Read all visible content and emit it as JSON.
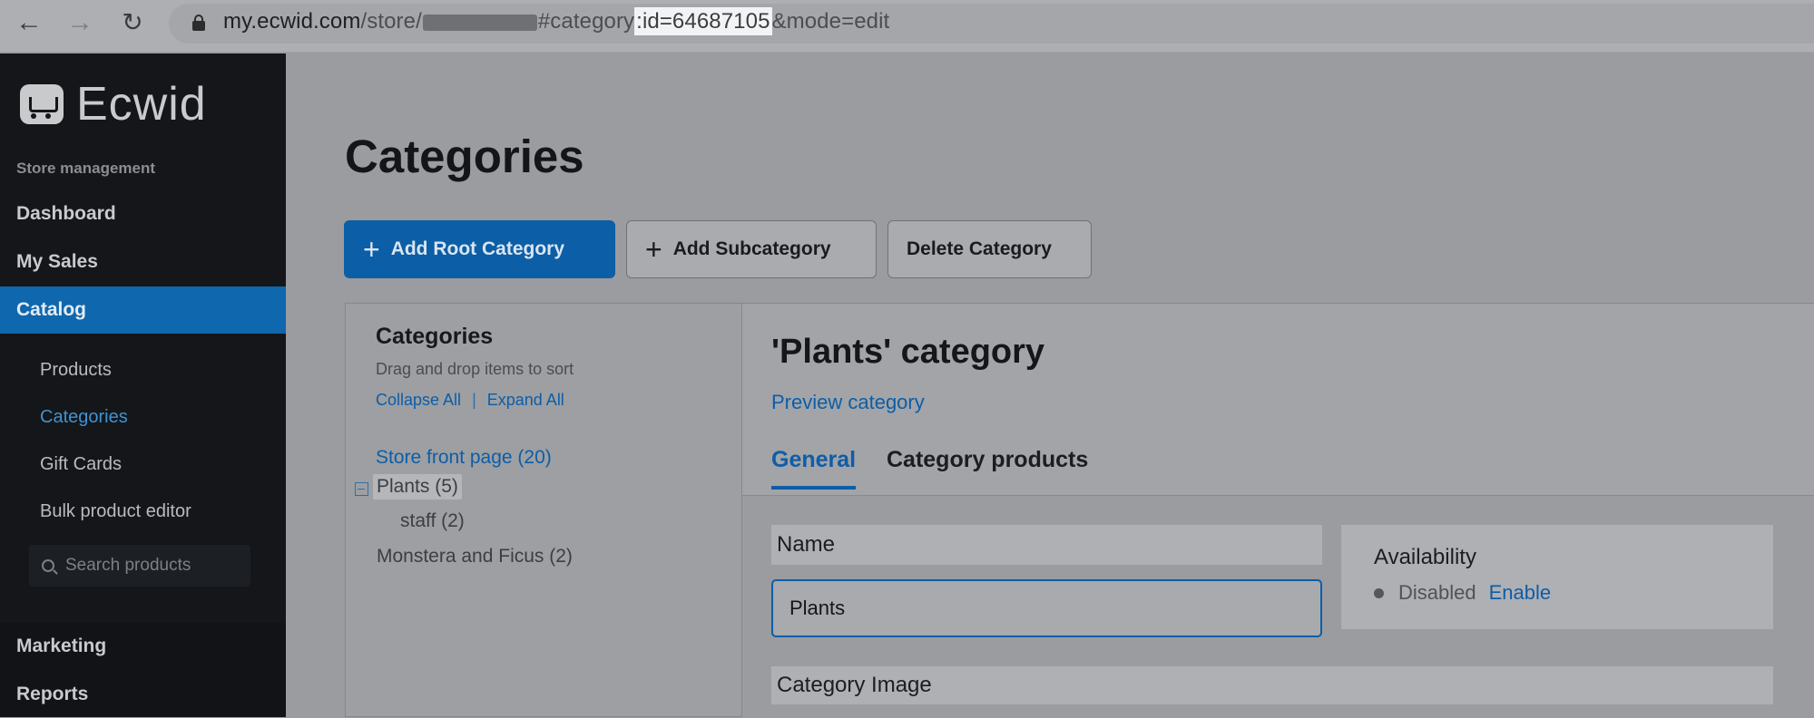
{
  "browser": {
    "url_host": "my.ecwid.com",
    "url_path_prefix": "/store/",
    "url_after_redact": "#category",
    "url_highlight": ":id=64687105",
    "url_suffix": "&mode=edit"
  },
  "sidebar": {
    "brand": "Ecwid",
    "section_label": "Store management",
    "items": [
      {
        "label": "Dashboard"
      },
      {
        "label": "My Sales"
      },
      {
        "label": "Catalog"
      }
    ],
    "sub_items": [
      {
        "label": "Products"
      },
      {
        "label": "Categories"
      },
      {
        "label": "Gift Cards"
      },
      {
        "label": "Bulk product editor"
      }
    ],
    "search_placeholder": "Search products",
    "bottom_items": [
      {
        "label": "Marketing"
      },
      {
        "label": "Reports"
      }
    ]
  },
  "main": {
    "title": "Categories",
    "buttons": {
      "add_root": "Add Root Category",
      "add_sub": "Add Subcategory",
      "delete": "Delete Category"
    }
  },
  "tree_panel": {
    "title": "Categories",
    "hint": "Drag and drop items to sort",
    "collapse_all": "Collapse All",
    "separator": "|",
    "expand_all": "Expand All",
    "root": "Store front page (20)",
    "items": [
      {
        "label": "Plants (5)"
      },
      {
        "label": "staff (2)"
      },
      {
        "label": "Monstera and Ficus (2)"
      }
    ]
  },
  "editor": {
    "title": "'Plants' category",
    "preview_link": "Preview category",
    "tabs": [
      {
        "label": "General"
      },
      {
        "label": "Category products"
      }
    ],
    "name_label": "Name",
    "name_value": "Plants",
    "availability_title": "Availability",
    "availability_status": "Disabled",
    "availability_action": "Enable",
    "image_label": "Category Image"
  },
  "colors": {
    "accent": "#0e5da6",
    "sidebar_bg": "#14161a",
    "active_nav": "#0f67ad"
  }
}
